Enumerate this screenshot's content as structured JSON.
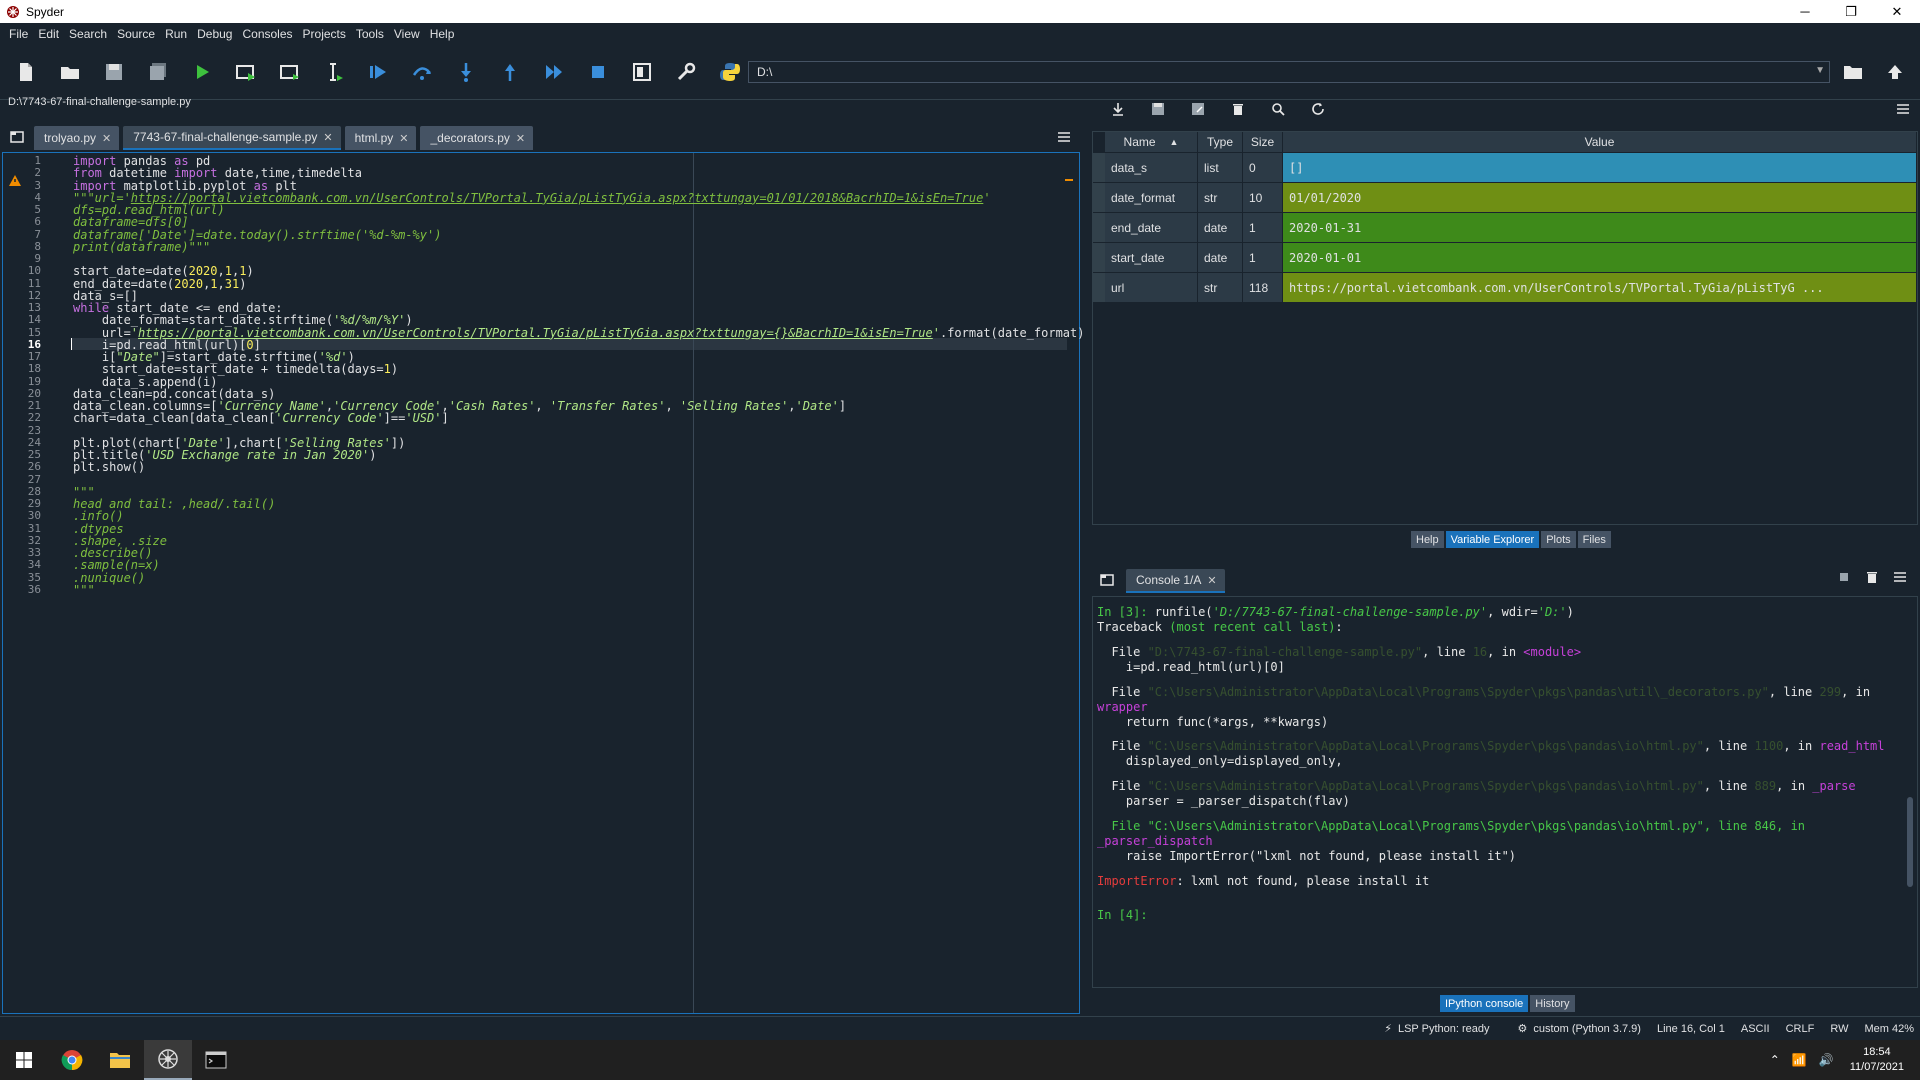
{
  "window": {
    "title": "Spyder",
    "minimize": "─",
    "maximize": "❐",
    "close": "✕"
  },
  "menu": [
    "File",
    "Edit",
    "Search",
    "Source",
    "Run",
    "Debug",
    "Consoles",
    "Projects",
    "Tools",
    "View",
    "Help"
  ],
  "toolbar": {
    "path": "D:\\"
  },
  "editor": {
    "file_path": "D:\\7743-67-final-challenge-sample.py",
    "tabs": [
      {
        "label": "trolyao.py",
        "active": false
      },
      {
        "label": "7743-67-final-challenge-sample.py",
        "active": true
      },
      {
        "label": "html.py",
        "active": false
      },
      {
        "label": "_decorators.py",
        "active": false
      }
    ],
    "current_line": 16,
    "lines": [
      [
        [
          "kw",
          "import"
        ],
        [
          "d",
          " pandas "
        ],
        [
          "kw",
          "as"
        ],
        [
          "d",
          " pd"
        ]
      ],
      [
        [
          "kw",
          "from"
        ],
        [
          "d",
          " datetime "
        ],
        [
          "kw",
          "import"
        ],
        [
          "d",
          " date,time,timedelta"
        ]
      ],
      [
        [
          "kw",
          "import"
        ],
        [
          "d",
          " matplotlib.pyplot "
        ],
        [
          "kw",
          "as"
        ],
        [
          "d",
          " plt"
        ]
      ],
      [
        [
          "cm",
          "\"\"\"url='"
        ],
        [
          "cmu",
          "https://portal.vietcombank.com.vn/UserControls/TVPortal.TyGia/pListTyGia.aspx?txttungay=01/01/2018&BacrhID=1&isEn=True"
        ],
        [
          "cm",
          "'"
        ]
      ],
      [
        [
          "cm",
          "dfs=pd.read_html(url)"
        ]
      ],
      [
        [
          "cm",
          "dataframe=dfs[0]"
        ]
      ],
      [
        [
          "cm",
          "dataframe['Date']=date.today().strftime('%d-%m-%y')"
        ]
      ],
      [
        [
          "cm",
          "print(dataframe)\"\"\""
        ]
      ],
      [
        [
          "d",
          ""
        ]
      ],
      [
        [
          "d",
          "start_date=date("
        ],
        [
          "nm",
          "2020"
        ],
        [
          "d",
          ","
        ],
        [
          "nm",
          "1"
        ],
        [
          "d",
          ","
        ],
        [
          "nm",
          "1"
        ],
        [
          "d",
          ")"
        ]
      ],
      [
        [
          "d",
          "end_date=date("
        ],
        [
          "nm",
          "2020"
        ],
        [
          "d",
          ","
        ],
        [
          "nm",
          "1"
        ],
        [
          "d",
          ","
        ],
        [
          "nm",
          "31"
        ],
        [
          "d",
          ")"
        ]
      ],
      [
        [
          "d",
          "data_s=[]"
        ]
      ],
      [
        [
          "kw",
          "while"
        ],
        [
          "d",
          " start_date <= end_date:"
        ]
      ],
      [
        [
          "d",
          "    date_format=start_date.strftime("
        ],
        [
          "st",
          "'%d/%m/%Y'"
        ],
        [
          "d",
          ")"
        ]
      ],
      [
        [
          "d",
          "    url="
        ],
        [
          "st",
          "'"
        ],
        [
          "stu",
          "https://portal.vietcombank.com.vn/UserControls/TVPortal.TyGia/pListTyGia.aspx?txttungay={}&BacrhID=1&isEn=True"
        ],
        [
          "st",
          "'"
        ],
        [
          "d",
          ".format(date_format)"
        ]
      ],
      [
        [
          "d",
          "    i=pd.read_html(url)["
        ],
        [
          "nm",
          "0"
        ],
        [
          "d",
          "]"
        ]
      ],
      [
        [
          "d",
          "    i["
        ],
        [
          "st",
          "\"Date\""
        ],
        [
          "d",
          "]=start_date.strftime("
        ],
        [
          "st",
          "'%d'"
        ],
        [
          "d",
          ")"
        ]
      ],
      [
        [
          "d",
          "    start_date=start_date + timedelta(days="
        ],
        [
          "nm",
          "1"
        ],
        [
          "d",
          ")"
        ]
      ],
      [
        [
          "d",
          "    data_s.append(i)"
        ]
      ],
      [
        [
          "d",
          "data_clean=pd.concat(data_s)"
        ]
      ],
      [
        [
          "d",
          "data_clean.columns=["
        ],
        [
          "st",
          "'Currency Name'"
        ],
        [
          "d",
          ","
        ],
        [
          "st",
          "'Currency Code'"
        ],
        [
          "d",
          ","
        ],
        [
          "st",
          "'Cash Rates'"
        ],
        [
          "d",
          ", "
        ],
        [
          "st",
          "'Transfer Rates'"
        ],
        [
          "d",
          ", "
        ],
        [
          "st",
          "'Selling Rates'"
        ],
        [
          "d",
          ","
        ],
        [
          "st",
          "'Date'"
        ],
        [
          "d",
          "]"
        ]
      ],
      [
        [
          "d",
          "chart=data_clean[data_clean["
        ],
        [
          "st",
          "'Currency Code'"
        ],
        [
          "d",
          "]=="
        ],
        [
          "st",
          "'USD'"
        ],
        [
          "d",
          "]"
        ]
      ],
      [
        [
          "d",
          ""
        ]
      ],
      [
        [
          "d",
          "plt.plot(chart["
        ],
        [
          "st",
          "'Date'"
        ],
        [
          "d",
          "],chart["
        ],
        [
          "st",
          "'Selling Rates'"
        ],
        [
          "d",
          "])"
        ]
      ],
      [
        [
          "d",
          "plt.title("
        ],
        [
          "st",
          "'USD Exchange rate in Jan 2020'"
        ],
        [
          "d",
          ")"
        ]
      ],
      [
        [
          "d",
          "plt.show()"
        ]
      ],
      [
        [
          "d",
          ""
        ]
      ],
      [
        [
          "cm",
          "\"\"\""
        ]
      ],
      [
        [
          "cm",
          "head and tail: ,head/.tail()"
        ]
      ],
      [
        [
          "cm",
          ".info()"
        ]
      ],
      [
        [
          "cm",
          ".dtypes"
        ]
      ],
      [
        [
          "cm",
          ".shape, .size"
        ]
      ],
      [
        [
          "cm",
          ".describe()"
        ]
      ],
      [
        [
          "cm",
          ".sample(n=x)"
        ]
      ],
      [
        [
          "cm",
          ".nunique()"
        ]
      ],
      [
        [
          "cm",
          "\"\"\""
        ]
      ]
    ]
  },
  "variable_explorer": {
    "headers": {
      "name": "Name",
      "type": "Type",
      "size": "Size",
      "value": "Value"
    },
    "rows": [
      {
        "name": "data_s",
        "type": "list",
        "size": "0",
        "value": "[]",
        "color": "#2e8fb5"
      },
      {
        "name": "date_format",
        "type": "str",
        "size": "10",
        "value": "01/01/2020",
        "color": "#6f8f14"
      },
      {
        "name": "end_date",
        "type": "date",
        "size": "1",
        "value": "2020-01-31",
        "color": "#3e8a1a"
      },
      {
        "name": "start_date",
        "type": "date",
        "size": "1",
        "value": "2020-01-01",
        "color": "#3e8a1a"
      },
      {
        "name": "url",
        "type": "str",
        "size": "118",
        "value": "https://portal.vietcombank.com.vn/UserControls/TVPortal.TyGia/pListTyG ...",
        "color": "#6f8f14"
      }
    ],
    "tabs": [
      {
        "label": "Help",
        "active": false
      },
      {
        "label": "Variable Explorer",
        "active": true
      },
      {
        "label": "Plots",
        "active": false
      },
      {
        "label": "Files",
        "active": false
      }
    ]
  },
  "console": {
    "tab_label": "Console 1/A",
    "lines": [
      [
        [
          "g",
          "In [3]: "
        ],
        [
          "w",
          "runfile("
        ],
        [
          "gi",
          "'D:/7743-67-final-challenge-sample.py'"
        ],
        [
          "w",
          ", wdir="
        ],
        [
          "gi",
          "'D:'"
        ],
        [
          "w",
          ")"
        ]
      ],
      [
        [
          "w",
          "Traceback "
        ],
        [
          "g",
          "(most recent call last)"
        ],
        [
          "w",
          ":"
        ]
      ],
      [
        [
          "w",
          ""
        ]
      ],
      [
        [
          "w",
          "  File "
        ],
        [
          "dim",
          "\"D:\\7743-67-final-challenge-sample.py\""
        ],
        [
          "w",
          ", line "
        ],
        [
          "dim",
          "16"
        ],
        [
          "w",
          ", in "
        ],
        [
          "p",
          "<module>"
        ]
      ],
      [
        [
          "w",
          "    i=pd.read_html(url)[0]"
        ]
      ],
      [
        [
          "w",
          ""
        ]
      ],
      [
        [
          "w",
          "  File "
        ],
        [
          "dim",
          "\"C:\\Users\\Administrator\\AppData\\Local\\Programs\\Spyder\\pkgs\\pandas\\util\\_decorators.py\""
        ],
        [
          "w",
          ", line "
        ],
        [
          "dim",
          "299"
        ],
        [
          "w",
          ", in"
        ]
      ],
      [
        [
          "p",
          "wrapper"
        ]
      ],
      [
        [
          "w",
          "    return func(*args, **kwargs)"
        ]
      ],
      [
        [
          "w",
          ""
        ]
      ],
      [
        [
          "w",
          "  File "
        ],
        [
          "dim",
          "\"C:\\Users\\Administrator\\AppData\\Local\\Programs\\Spyder\\pkgs\\pandas\\io\\html.py\""
        ],
        [
          "w",
          ", line "
        ],
        [
          "dim",
          "1100"
        ],
        [
          "w",
          ", in "
        ],
        [
          "p",
          "read_html"
        ]
      ],
      [
        [
          "w",
          "    displayed_only=displayed_only,"
        ]
      ],
      [
        [
          "w",
          ""
        ]
      ],
      [
        [
          "w",
          "  File "
        ],
        [
          "dim",
          "\"C:\\Users\\Administrator\\AppData\\Local\\Programs\\Spyder\\pkgs\\pandas\\io\\html.py\""
        ],
        [
          "w",
          ", line "
        ],
        [
          "dim",
          "889"
        ],
        [
          "w",
          ", in "
        ],
        [
          "p",
          "_parse"
        ]
      ],
      [
        [
          "w",
          "    parser = _parser_dispatch(flav)"
        ]
      ],
      [
        [
          "w",
          ""
        ]
      ],
      [
        [
          "g",
          "  File \"C:\\Users\\Administrator\\AppData\\Local\\Programs\\Spyder\\pkgs\\pandas\\io\\html.py\", line 846, in"
        ]
      ],
      [
        [
          "p",
          "_parser_dispatch"
        ]
      ],
      [
        [
          "w",
          "    raise ImportError(\"lxml not found, please install it\")"
        ]
      ],
      [
        [
          "w",
          ""
        ]
      ],
      [
        [
          "r",
          "ImportError"
        ],
        [
          "w",
          ": lxml not found, please install it"
        ]
      ],
      [
        [
          "w",
          ""
        ]
      ],
      [
        [
          "w",
          ""
        ]
      ],
      [
        [
          "g",
          "In [4]:"
        ]
      ]
    ],
    "bottom_tabs": [
      {
        "label": "IPython console",
        "active": true
      },
      {
        "label": "History",
        "active": false
      }
    ]
  },
  "statusbar": {
    "lsp": "LSP Python: ready",
    "env": "custom (Python 3.7.9)",
    "cursor": "Line 16, Col 1",
    "encoding": "ASCII",
    "eol": "CRLF",
    "rw": "RW",
    "mem": "Mem 42%"
  },
  "taskbar": {
    "time": "18:54",
    "date": "11/07/2021"
  },
  "colors": {
    "accent": "#1a72bb",
    "background": "#19232d",
    "panel": "#2c3a46"
  }
}
